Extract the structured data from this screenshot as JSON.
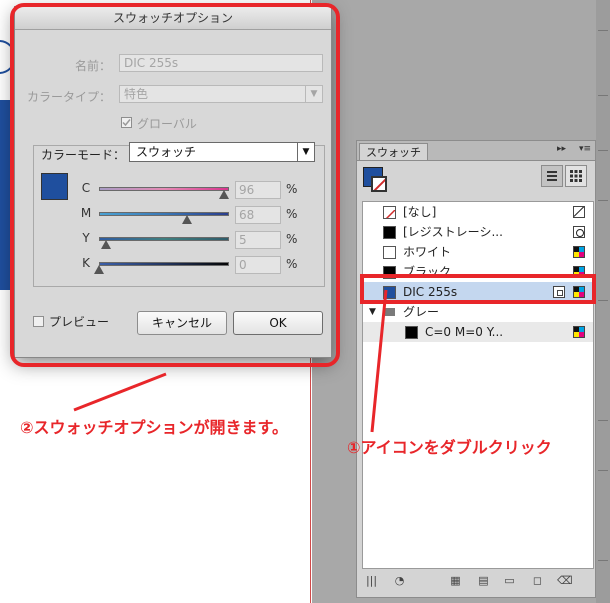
{
  "dialog": {
    "title": "スウォッチオプション",
    "name_label": "名前：",
    "name_value": "DIC 255s",
    "color_type_label": "カラータイプ：",
    "color_type_value": "特色",
    "global_label": "グローバル",
    "global_checked": true,
    "color_mode_label": "カラーモード：",
    "color_mode_value": "スウォッチ",
    "swatch_color": "#1f4f9e",
    "sliders": [
      {
        "label": "C",
        "value": "96",
        "level": 96
      },
      {
        "label": "M",
        "value": "68",
        "level": 68
      },
      {
        "label": "Y",
        "value": "5",
        "level": 5
      },
      {
        "label": "K",
        "value": "0",
        "level": 0
      }
    ],
    "percent": "%",
    "preview_label": "プレビュー",
    "cancel_label": "キャンセル",
    "ok_label": "OK"
  },
  "panel": {
    "tab_label": "スウォッチ",
    "swatches": [
      {
        "name": "[なし]",
        "chip": "none",
        "type_icon": "none-icon"
      },
      {
        "name": "[レジストレーシ...",
        "chip": "#000000",
        "type_icon": "registration-icon"
      },
      {
        "name": "ホワイト",
        "chip": "#ffffff",
        "type_icon": "cmyk-icon"
      },
      {
        "name": "ブラック",
        "chip": "#000000",
        "type_icon": "cmyk-icon"
      },
      {
        "name": "DIC 255s",
        "chip": "#1f4f9e",
        "type_icon": "cmyk-icon",
        "selected": true
      },
      {
        "name": "グレー",
        "chip": "folder",
        "type_icon": "",
        "group": true
      },
      {
        "name": "C=0 M=0 Y...",
        "chip": "#000000",
        "type_icon": "cmyk-icon",
        "indent": true
      }
    ]
  },
  "annotations": {
    "open_dialog": "②スウォッチオプションが開きます。",
    "double_click": "①アイコンをダブルクリック"
  },
  "colors": {
    "annotation_red": "#e8262a",
    "swatch_blue": "#1f4f9e"
  }
}
